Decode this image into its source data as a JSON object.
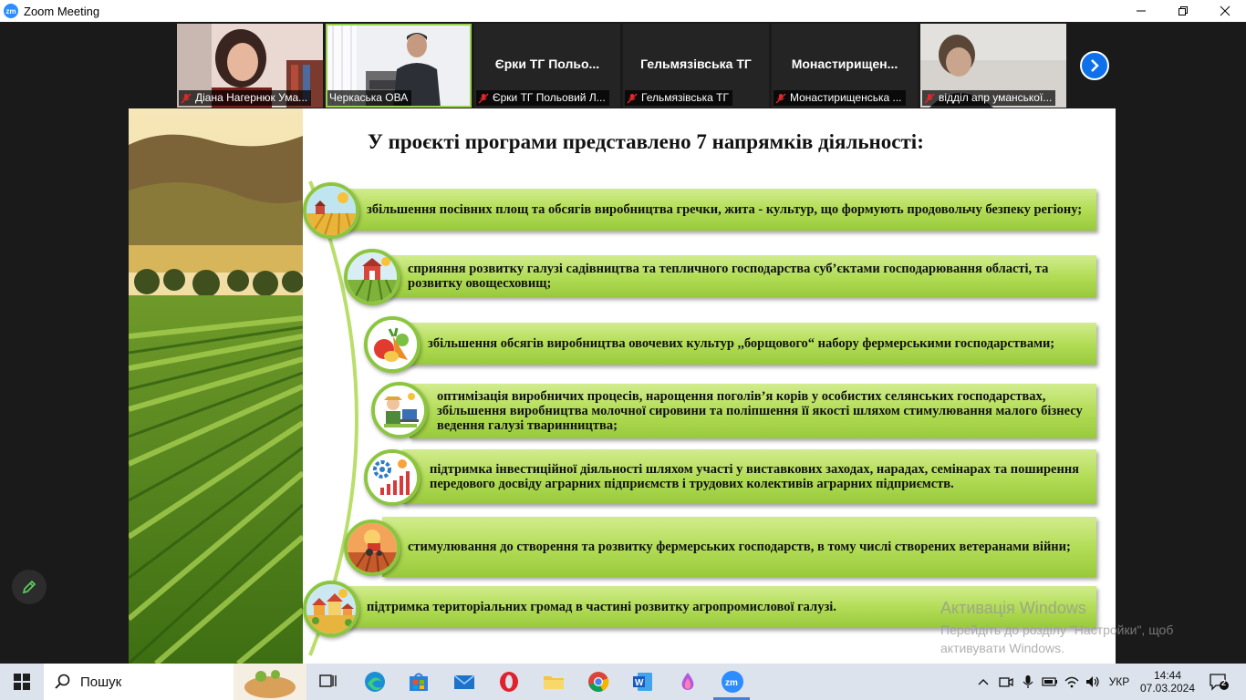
{
  "window": {
    "title": "Zoom Meeting",
    "app_logo_text": "zm"
  },
  "gallery": [
    {
      "big_name": "",
      "label": "Діана Нагернюк Ума...",
      "muted": true
    },
    {
      "big_name": "",
      "label": "Черкаська ОВА",
      "muted": false,
      "active": true
    },
    {
      "big_name": "Єрки ТГ Польо...",
      "label": "Єрки ТГ Польовий Л...",
      "muted": true
    },
    {
      "big_name": "Гельмязівська ТГ",
      "label": "Гельмязівська ТГ",
      "muted": true
    },
    {
      "big_name": "Монастирищен...",
      "label": "Монастирищенська ...",
      "muted": true
    },
    {
      "big_name": "",
      "label": "відділ апр уманської...",
      "muted": true
    }
  ],
  "slide": {
    "title": "У проєкті програми представлено 7 напрямків діяльності:",
    "items": [
      "збільшення посівних площ та обсягів виробництва гречки, жита -  культур, що формують продовольчу безпеку регіону;",
      "сприяння розвитку галузі садівництва та тепличного господарства суб’єктами господарювання області, та розвитку овощесховищ;",
      "збільшення  обсягів виробництва овочевих культур ,,борщового“ набору  фермерськими господарствами;",
      "оптимізація виробничих процесів, нарощення поголів’я корів у особистих селянських господарствах, збільшення виробництва молочної сировини та поліпшення її якості шляхом стимулювання малого бізнесу ведення галузі тваринництва;",
      "підтримка інвестиційної діяльності шляхом участі у виставкових заходах, нарадах, семінарах та поширення передового досвіду аграрних підприємств і трудових колективів аграрних підприємств.",
      "стимулювання до створення та розвитку фермерських господарств, в тому числі створених ветеранами війни;",
      "підтримка територіальних громад в частині  розвитку агропромислової  галузі."
    ]
  },
  "watermark": {
    "line1": "Активація Windows",
    "line2": "Перейдіть до розділу \"Настройки\", щоб активувати Windows."
  },
  "taskbar": {
    "search_label": "Пошук",
    "language": "УКР",
    "time": "14:44",
    "date": "07.03.2024",
    "notifications": "2"
  },
  "colors": {
    "bar_green": "#b3dd57",
    "zoom_blue": "#0e71eb",
    "circle_border": "#8cc63f"
  }
}
